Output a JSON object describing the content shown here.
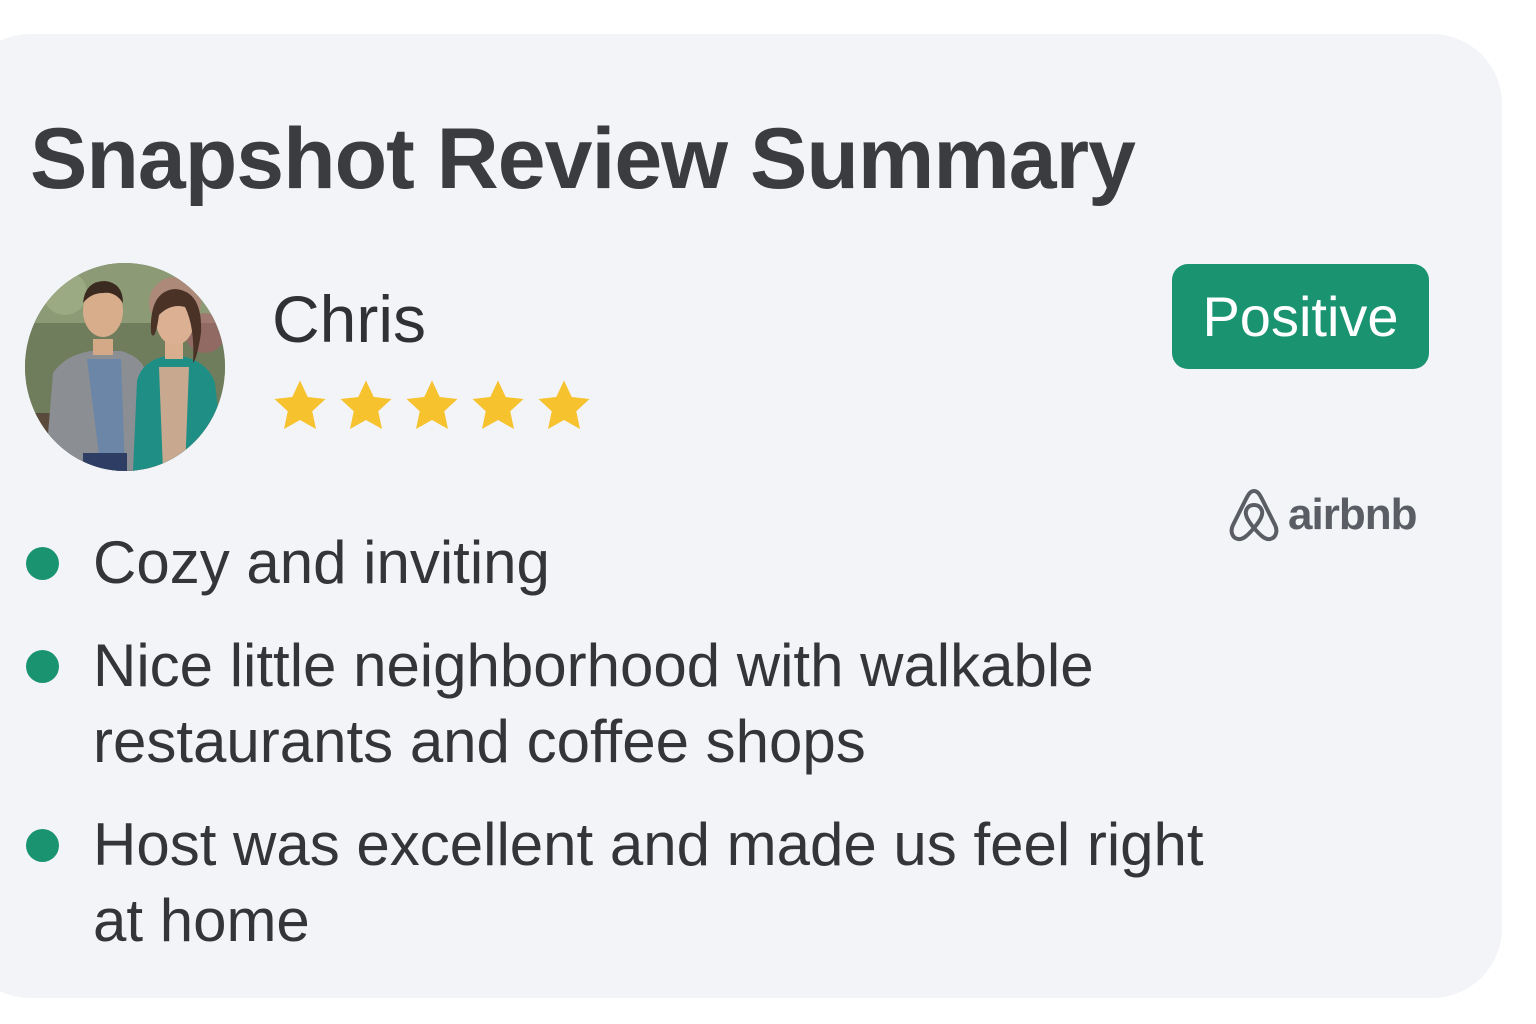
{
  "card": {
    "title": "Snapshot Review Summary"
  },
  "reviewer": {
    "name": "Chris",
    "avatar_icon": "reviewer-photo",
    "rating": 5,
    "rating_max": 5,
    "star_color": "#f6c22e"
  },
  "sentiment": {
    "label": "Positive",
    "color": "#1a9470"
  },
  "source": {
    "icon": "airbnb-logo-icon",
    "label": "airbnb"
  },
  "highlights": [
    "Cozy and inviting",
    "Nice little neighborhood with walkable restaurants and coffee shops",
    "Host was excellent and made us feel right at home"
  ],
  "colors": {
    "card_background": "#f2f4f8",
    "bullet": "#1a9470",
    "text": "#333538"
  }
}
